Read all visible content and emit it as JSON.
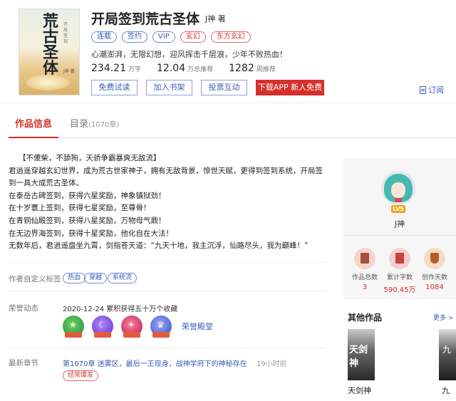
{
  "book": {
    "title": "开局签到荒古圣体",
    "author": "J神 著",
    "cover": {
      "title": "荒古圣体",
      "subtitle": "开局签到",
      "author": "J神 著"
    },
    "tags": [
      {
        "label": "连载",
        "style": "blue"
      },
      {
        "label": "签约",
        "style": "blue"
      },
      {
        "label": "VIP",
        "style": "blue"
      },
      {
        "label": "玄幻",
        "style": "red"
      },
      {
        "label": "东方玄幻",
        "style": "red"
      }
    ],
    "slogan": "心潮澎湃，无限幻想，迎风挥击千层浪，少年不败热血！",
    "stats": [
      {
        "value": "234.21",
        "unit": "万字"
      },
      {
        "value": "12.04",
        "unit": "万总推荐"
      },
      {
        "value": "1282",
        "unit": "周推荐"
      }
    ]
  },
  "buttons": {
    "trial": "免费试读",
    "shelf": "加入书架",
    "vote": "投票互动",
    "app": "下载APP 新人免费读",
    "subscribe": "订阅"
  },
  "tabs": {
    "info": "作品信息",
    "catalog": "目录",
    "catalog_count": "(1070章)"
  },
  "intro": [
    "【不傻柴，不舔狗，天骄争霸暴爽无敌流】",
    "君逍遥穿越玄幻世界，成为荒古世家神子，拥有无敌背景，惊世天赋，更得到签到系统，开局签到一具大成荒古圣体。",
    "在泰岳古碑签到，获得六星奖励，神象镇狱劲！",
    "在十岁寰上签到，获得七星奖励，至尊骨！",
    "在青铜仙殿签到，获得八星奖励，万物母气鼎！",
    "在无边界海签到，获得十星奖励，他化自在大法！",
    "无数年后，君逍遥盘坐九霄，剑指苍天道：“九天十地，我主沉浮，仙路尽头，我为巅峰！”"
  ],
  "custom_tags": {
    "label": "作者自定义标签",
    "items": [
      "热血",
      "穿越",
      "系统流"
    ]
  },
  "honor": {
    "label": "荣誉动态",
    "text": "2020-12-24 累积获得五十万个收藏",
    "link": "荣誉殿堂",
    "colors": [
      "#1b8a3a",
      "#5b2fbf",
      "#b21b4f",
      "#3a4ac2"
    ]
  },
  "latest": {
    "label": "最新章节",
    "chapter": "第1070章 迷雾区，最后一王现身，战神学府下的神秘存在",
    "time": "19小时前",
    "badge": "经常爆发"
  },
  "author_panel": {
    "level": "LV5",
    "name": "J神",
    "stats": [
      {
        "label": "作品总数",
        "value": "3"
      },
      {
        "label": "累计字数",
        "value": "590.45万"
      },
      {
        "label": "创作天数",
        "value": "1084"
      }
    ]
  },
  "other_works": {
    "title": "其他作品",
    "more": "更多 >",
    "items": [
      {
        "name": "天剑神",
        "cover_text": "天剑神"
      },
      {
        "name": "九",
        "cover_text": "九"
      }
    ]
  }
}
